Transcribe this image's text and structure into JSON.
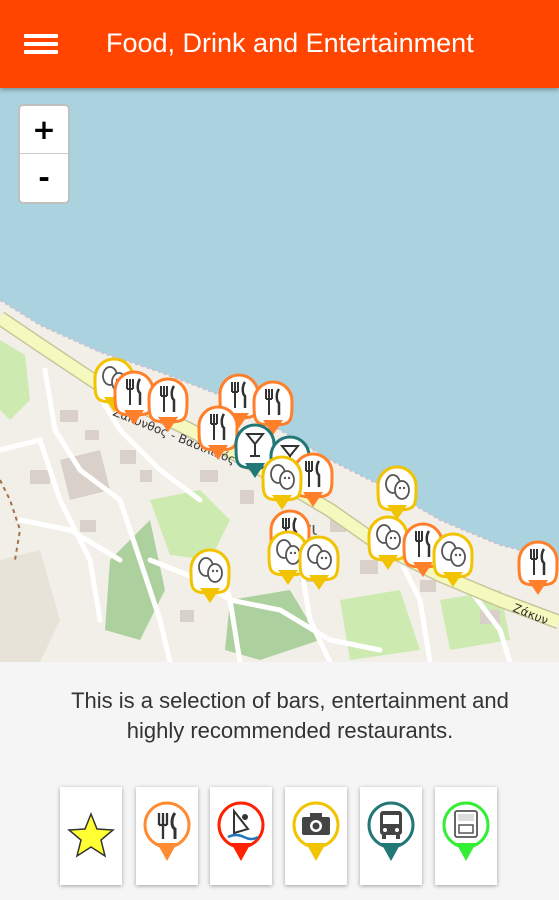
{
  "app_bar": {
    "title": "Food, Drink and Entertainment",
    "menu_icon": "hamburger-menu-icon",
    "color": "#ff4500"
  },
  "map": {
    "zoom_in_label": "+",
    "zoom_out_label": "-",
    "road_label": "Ζάκυνθος - Βασιλικός",
    "road_label_right": "Ζάκυν",
    "place_label": "Α   άσι",
    "sea_color": "#aad3df",
    "land_color": "#f2efe9",
    "road_color": "#f6f9be"
  },
  "description": {
    "line1": "This is a selection of bars, entertainment and",
    "line2": "highly recommended restaurants."
  },
  "categories": [
    {
      "name": "favourites",
      "icon": "star-icon",
      "color": "#ffff33"
    },
    {
      "name": "restaurants",
      "icon": "fork-knife-icon",
      "color": "#ff8c33"
    },
    {
      "name": "water-sports",
      "icon": "windsurf-icon",
      "color": "#ff2200"
    },
    {
      "name": "sightseeing",
      "icon": "camera-icon",
      "color": "#f2c300"
    },
    {
      "name": "transport",
      "icon": "bus-icon",
      "color": "#227777"
    },
    {
      "name": "atm",
      "icon": "atm-icon",
      "color": "#33ee33"
    }
  ]
}
